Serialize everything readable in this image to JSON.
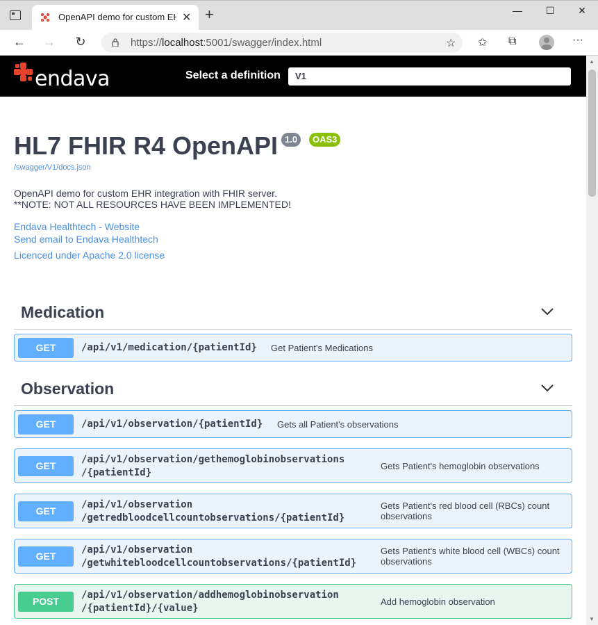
{
  "browser": {
    "tab_title": "OpenAPI demo for custom EHR i",
    "url_prefix": "https://",
    "url_host": "localhost",
    "url_rest": ":5001/swagger/index.html"
  },
  "topbar": {
    "logo_text": "endava",
    "select_label": "Select a definition",
    "select_value": "V1"
  },
  "info": {
    "title": "HL7 FHIR R4 OpenAPI",
    "version": "1.0",
    "oas": "OAS3",
    "docs_link": "/swagger/V1/docs.json",
    "description_line1": "OpenAPI demo for custom EHR integration with FHIR server.",
    "description_line2": "**NOTE: NOT ALL RESOURCES HAVE BEEN IMPLEMENTED!",
    "website_link": "Endava Healthtech - Website",
    "email_link": "Send email to Endava Healthtech",
    "license_link": "Licenced under Apache 2.0 license"
  },
  "sections": [
    {
      "title": "Medication",
      "operations": [
        {
          "method": "GET",
          "path1": "/api/v1/medication/{patientId}",
          "summary1": "Get Patient's Medications"
        }
      ]
    },
    {
      "title": "Observation",
      "operations": [
        {
          "method": "GET",
          "path1": "/api/v1/observation/{patientId}",
          "summary1": "Gets all Patient's observations"
        },
        {
          "method": "GET",
          "path1": "/api/v1/observation/gethemoglobinobservations",
          "path2": "/{patientId}",
          "summary1": "Gets Patient's hemoglobin observations"
        },
        {
          "method": "GET",
          "path1": "/api/v1/observation",
          "path2": "/getredbloodcellcountobservations/{patientId}",
          "summary1": "Gets Patient's red blood cell (RBCs) count",
          "summary2": "observations"
        },
        {
          "method": "GET",
          "path1": "/api/v1/observation",
          "path2": "/getwhitebloodcellcountobservations/{patientId}",
          "summary1": "Gets Patient's white blood cell (WBCs) count",
          "summary2": "observations"
        },
        {
          "method": "POST",
          "path1": "/api/v1/observation/addhemoglobinobservation",
          "path2": "/{patientId}/{value}",
          "summary1": "Add hemoglobin observation"
        }
      ]
    }
  ],
  "colors": {
    "get": "#61affe",
    "post": "#49cc90",
    "link": "#4990e2",
    "text": "#3b4151"
  }
}
